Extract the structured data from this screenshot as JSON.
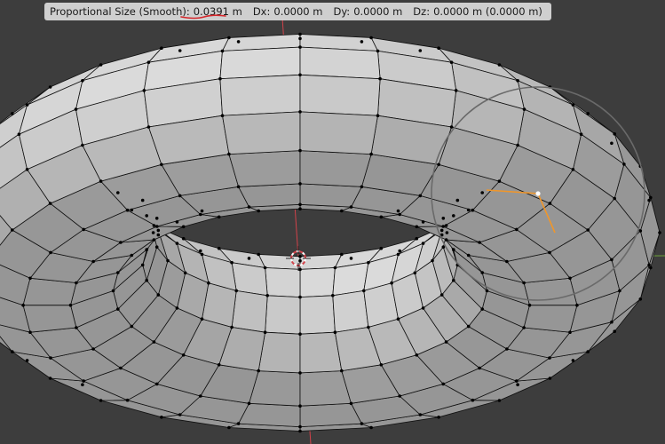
{
  "header": {
    "prop_label": "Proportional Size (Smooth):",
    "prop_value": "0.0391 m",
    "dx_label": "Dx:",
    "dx_value": "0.0000 m",
    "dy_label": "Dy:",
    "dy_value": "0.0000 m",
    "dz_label": "Dz:",
    "dz_value": "0.0000 m (0.0000 m)"
  },
  "colors": {
    "background": "#3d3d3d",
    "x_axis": "#d2424a",
    "y_axis": "#6ea33a",
    "mesh_face": "#b9b9b9",
    "mesh_edge": "#111111",
    "selected_edge": "#f0962a",
    "proportional_circle": "#6a6a6a",
    "annotation_underline": "#d6272b"
  }
}
